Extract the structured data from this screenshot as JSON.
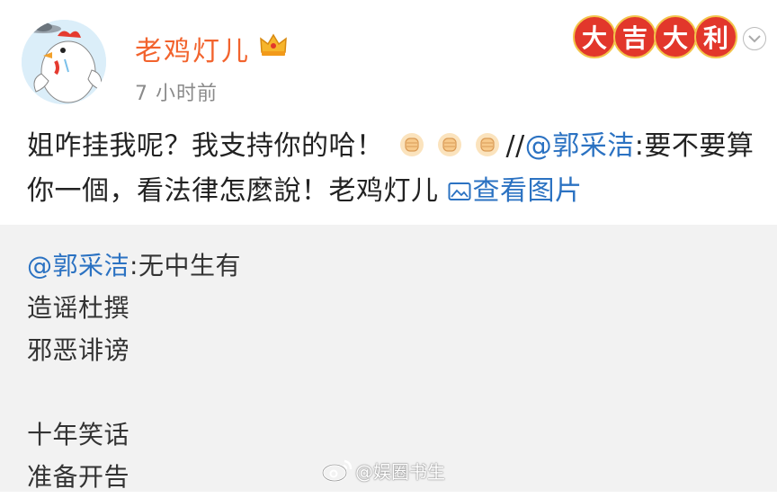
{
  "header": {
    "username": "老鸡灯儿",
    "timestamp": "7 小时前",
    "badge_chars": [
      "大",
      "吉",
      "大",
      "利"
    ],
    "avatar_icon": "chicken-avatar",
    "crown_icon": "crown-icon",
    "menu_icon": "chevron-down-icon"
  },
  "post": {
    "text_before_emoji": "姐咋挂我呢？我支持你的哈！",
    "emoji_icon": "fist-emoji",
    "emoji_count": 3,
    "slashes": "//",
    "mention": "@郭采洁",
    "text_after_mention": ":要不要算你一個，看法律怎麼說！老鸡灯儿",
    "view_picture": "查看图片"
  },
  "repost": {
    "mention": "@郭采洁",
    "first_line_rest": ":无中生有",
    "lines": [
      "造谣杜撰",
      "邪恶诽谤",
      "",
      "十年笑话",
      "准备开告"
    ]
  },
  "watermark": {
    "text": "@娱圈书生",
    "icon": "weibo-icon"
  },
  "colors": {
    "username": "#f2632d",
    "link": "#2b72c2",
    "badge_bg": "#e2372b",
    "repost_bg": "#f2f2f2"
  }
}
